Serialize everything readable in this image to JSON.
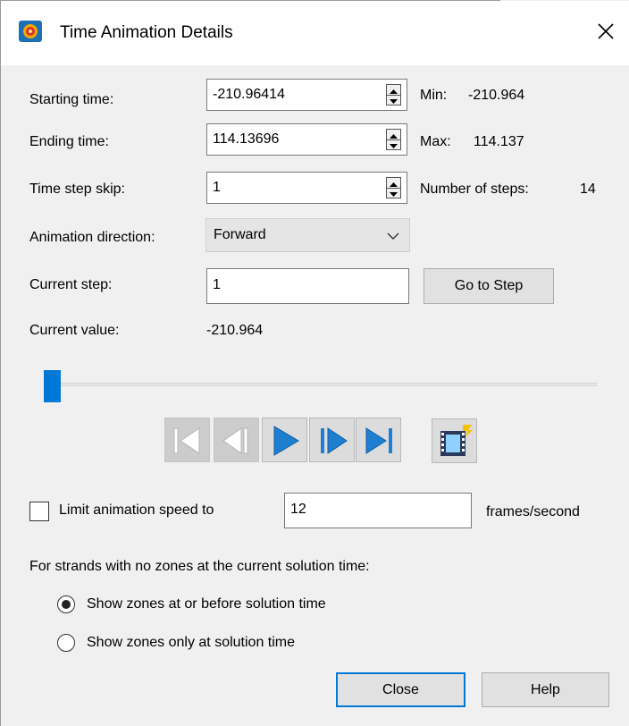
{
  "window": {
    "title": "Time Animation Details",
    "icon": "app-logo-icon",
    "close_icon": "close-icon"
  },
  "fields": {
    "starting_time": {
      "label": "Starting time:",
      "value": "-210.96414",
      "range_label": "Min:",
      "range_value": "-210.964"
    },
    "ending_time": {
      "label": "Ending time:",
      "value": "114.13696",
      "range_label": "Max:",
      "range_value": "114.137"
    },
    "time_step_skip": {
      "label": "Time step skip:",
      "value": "1",
      "info_label": "Number of steps:",
      "info_value": "14"
    },
    "animation_direction": {
      "label": "Animation direction:",
      "selected": "Forward"
    },
    "current_step": {
      "label": "Current step:",
      "value": "1",
      "button": "Go to Step"
    },
    "current_value": {
      "label": "Current value:",
      "value": "-210.964"
    }
  },
  "slider": {
    "value_step": 1,
    "total_steps": 14,
    "accent": "#0078d7"
  },
  "playback": {
    "buttons": [
      {
        "name": "first-frame",
        "icon": "skip-to-start-icon",
        "enabled": false
      },
      {
        "name": "step-back",
        "icon": "step-back-icon",
        "enabled": false
      },
      {
        "name": "play",
        "icon": "play-icon",
        "enabled": true
      },
      {
        "name": "step-forward",
        "icon": "step-forward-icon",
        "enabled": true
      },
      {
        "name": "last-frame",
        "icon": "skip-to-end-icon",
        "enabled": true
      },
      {
        "name": "record-movie",
        "icon": "movie-film-icon",
        "enabled": true
      }
    ],
    "enabled_color": "#1e7fd0",
    "disabled_color": "#ffffff"
  },
  "speed_limit": {
    "checked": false,
    "label": "Limit animation speed to",
    "value": "12",
    "unit": "frames/second"
  },
  "strands": {
    "heading": "For strands with no zones at the current solution time:",
    "options": [
      {
        "label": "Show zones at or before solution time",
        "selected": true
      },
      {
        "label": "Show zones only at solution time",
        "selected": false
      }
    ]
  },
  "actions": {
    "close": "Close",
    "help": "Help"
  }
}
